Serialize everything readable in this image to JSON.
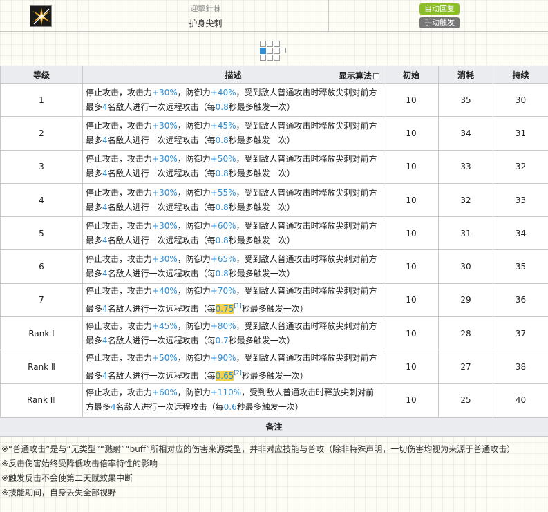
{
  "skill": {
    "icon": "thorn-burst-icon",
    "subname": "迎擊針棘",
    "name": "护身尖刺",
    "badge_auto": "自动回复",
    "badge_manual": "手动触发"
  },
  "table": {
    "headers": {
      "level": "等级",
      "desc": "描述",
      "algo": "显示算法",
      "initial": "初始",
      "cost": "消耗",
      "duration": "持续"
    },
    "desc_tpl": {
      "p1": "停止攻击，攻击力",
      "p2": "，防御力",
      "p3": "，受到敌人普通攻击时释放尖刺对前方最多",
      "p3b": "，受到敌人普通攻击时释放尖刺对前方最多",
      "targets": "4",
      "p4": "名敌人进行一次远程攻击（每",
      "p5": "秒最多触发一次）"
    },
    "rows": [
      {
        "level": "1",
        "atk": "+30%",
        "def": "+40%",
        "interval": "0.8",
        "ref": "",
        "initial": "10",
        "cost": "35",
        "duration": "30"
      },
      {
        "level": "2",
        "atk": "+30%",
        "def": "+45%",
        "interval": "0.8",
        "ref": "",
        "initial": "10",
        "cost": "34",
        "duration": "31"
      },
      {
        "level": "3",
        "atk": "+30%",
        "def": "+50%",
        "interval": "0.8",
        "ref": "",
        "initial": "10",
        "cost": "33",
        "duration": "32"
      },
      {
        "level": "4",
        "atk": "+30%",
        "def": "+55%",
        "interval": "0.8",
        "ref": "",
        "initial": "10",
        "cost": "32",
        "duration": "33"
      },
      {
        "level": "5",
        "atk": "+30%",
        "def": "+60%",
        "interval": "0.8",
        "ref": "",
        "initial": "10",
        "cost": "31",
        "duration": "34"
      },
      {
        "level": "6",
        "atk": "+30%",
        "def": "+65%",
        "interval": "0.8",
        "ref": "",
        "initial": "10",
        "cost": "30",
        "duration": "35"
      },
      {
        "level": "7",
        "atk": "+40%",
        "def": "+70%",
        "interval": "0.75",
        "ref": "[1]",
        "initial": "10",
        "cost": "29",
        "duration": "36"
      },
      {
        "level": "Rank Ⅰ",
        "atk": "+45%",
        "def": "+80%",
        "interval": "0.7",
        "ref": "",
        "initial": "10",
        "cost": "28",
        "duration": "37"
      },
      {
        "level": "Rank Ⅱ",
        "atk": "+50%",
        "def": "+90%",
        "interval": "0.65",
        "ref": "[2]",
        "initial": "10",
        "cost": "27",
        "duration": "38"
      },
      {
        "level": "Rank Ⅲ",
        "atk": "+60%",
        "def": "+110%",
        "interval": "0.6",
        "ref": "",
        "initial": "10",
        "cost": "25",
        "duration": "40"
      }
    ]
  },
  "notes": {
    "title": "备注",
    "items": [
      "※“普通攻击”是与“无类型”“溅射”“buff”所相对应的伤害来源类型，并非对应技能与普攻（除非特殊声明，一切伤害均视为来源于普通攻击）",
      "※反击伤害始终受降低攻击倍率特性的影响",
      "※触发反击不会使第二天赋效果中断",
      "※技能期间，自身丢失全部视野"
    ]
  },
  "colors": {
    "accent_blue": "#2f8fd8",
    "highlight": "#f5d24a",
    "badge_auto": "#8cbf26",
    "badge_manual": "#777777",
    "header_bg": "#eaecf0"
  }
}
